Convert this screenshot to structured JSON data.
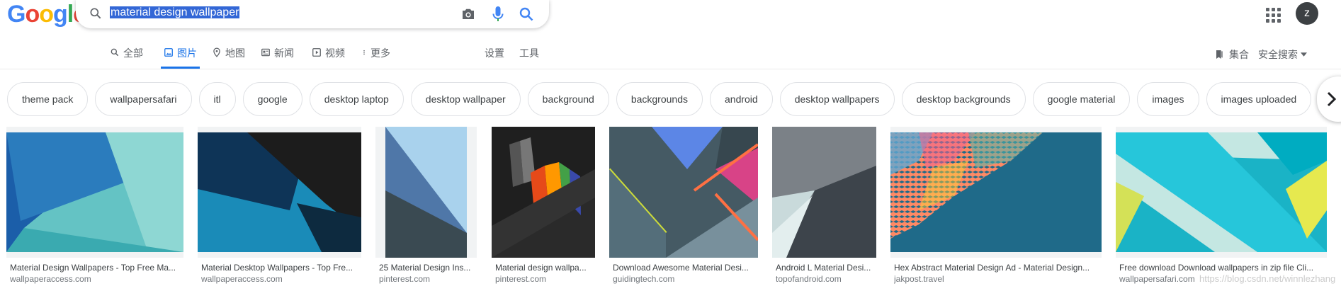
{
  "logo": {
    "letters": [
      "G",
      "o",
      "o",
      "g",
      "l",
      "e"
    ],
    "colors": [
      "#4285f4",
      "#ea4335",
      "#fbbc05",
      "#4285f4",
      "#34a853",
      "#ea4335"
    ]
  },
  "search": {
    "query": "material design wallpaper"
  },
  "header": {
    "avatar_initial": "z"
  },
  "tabs": [
    {
      "label": "全部",
      "icon": "search-icon"
    },
    {
      "label": "图片",
      "icon": "image-icon",
      "active": true
    },
    {
      "label": "地图",
      "icon": "map-pin-icon"
    },
    {
      "label": "新闻",
      "icon": "news-icon"
    },
    {
      "label": "视频",
      "icon": "video-icon"
    },
    {
      "label": "更多",
      "icon": "more-vert-icon"
    }
  ],
  "tools": {
    "settings": "设置",
    "tools": "工具"
  },
  "right_links": {
    "collections": "集合",
    "safesearch": "安全搜索"
  },
  "chips": [
    "theme pack",
    "wallpapersafari",
    "itl",
    "google",
    "desktop laptop",
    "desktop wallpaper",
    "background",
    "backgrounds",
    "android",
    "desktop wallpapers",
    "desktop backgrounds",
    "google material",
    "images",
    "images uploaded"
  ],
  "results": [
    {
      "title": "Material Design Wallpapers - Top Free Ma...",
      "source": "wallpaperaccess.com"
    },
    {
      "title": "Material Desktop Wallpapers - Top Fre...",
      "source": "wallpaperaccess.com"
    },
    {
      "title": "25 Material Design Ins...",
      "source": "pinterest.com"
    },
    {
      "title": "Material design wallpa...",
      "source": "pinterest.com"
    },
    {
      "title": "Download Awesome Material Desi...",
      "source": "guidingtech.com"
    },
    {
      "title": "Android L Material Desi...",
      "source": "topofandroid.com"
    },
    {
      "title": "Hex Abstract Material Design Ad - Material Design...",
      "source": "jakpost.travel"
    },
    {
      "title": "Free download Download wallpapers in zip file Cli...",
      "source": "wallpapersafari.com"
    }
  ],
  "watermark": "https://blog.csdn.net/winnlezhang",
  "colors": {
    "accent": "#1a73e8",
    "selection": "#3367d6"
  }
}
